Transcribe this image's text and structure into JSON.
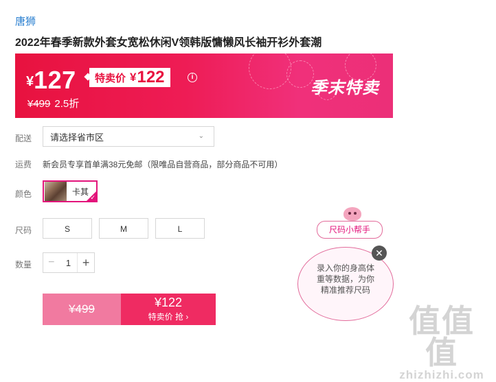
{
  "product": {
    "brand": "唐狮",
    "title": "2022年春季新款外套女宽松休闲V领韩版慵懒风长袖开衫外套潮"
  },
  "price": {
    "currency": "¥",
    "current": "127",
    "special_label": "特卖价",
    "special_price": "122",
    "info_icon": "i",
    "original": "¥499",
    "discount": "2.5折",
    "season_label": "季末特卖",
    "accent": "#e8123f"
  },
  "delivery": {
    "label": "配送",
    "placeholder": "请选择省市区",
    "chevron": "⌄"
  },
  "shipping": {
    "label": "运费",
    "text": "新会员专享首单满38元免邮（限唯品自营商品，部分商品不可用）"
  },
  "color": {
    "label": "颜色",
    "option": "卡其",
    "selected_color": "#e3147b"
  },
  "size": {
    "label": "尺码",
    "options": [
      "S",
      "M",
      "L"
    ]
  },
  "quantity": {
    "label": "数量",
    "minus": "−",
    "value": "1",
    "plus": "+"
  },
  "buy": {
    "original": "¥499",
    "special_price": "¥122",
    "special_sub": "特卖价 抢 ›"
  },
  "size_helper": {
    "pill": "尺码小帮手",
    "bubble_lines": [
      "录入你的身高体",
      "重等数据，为你",
      "精准推荐尺码"
    ],
    "close": "✕"
  },
  "watermark": {
    "top": "值值值",
    "bottom": "zhizhizhi.com"
  }
}
